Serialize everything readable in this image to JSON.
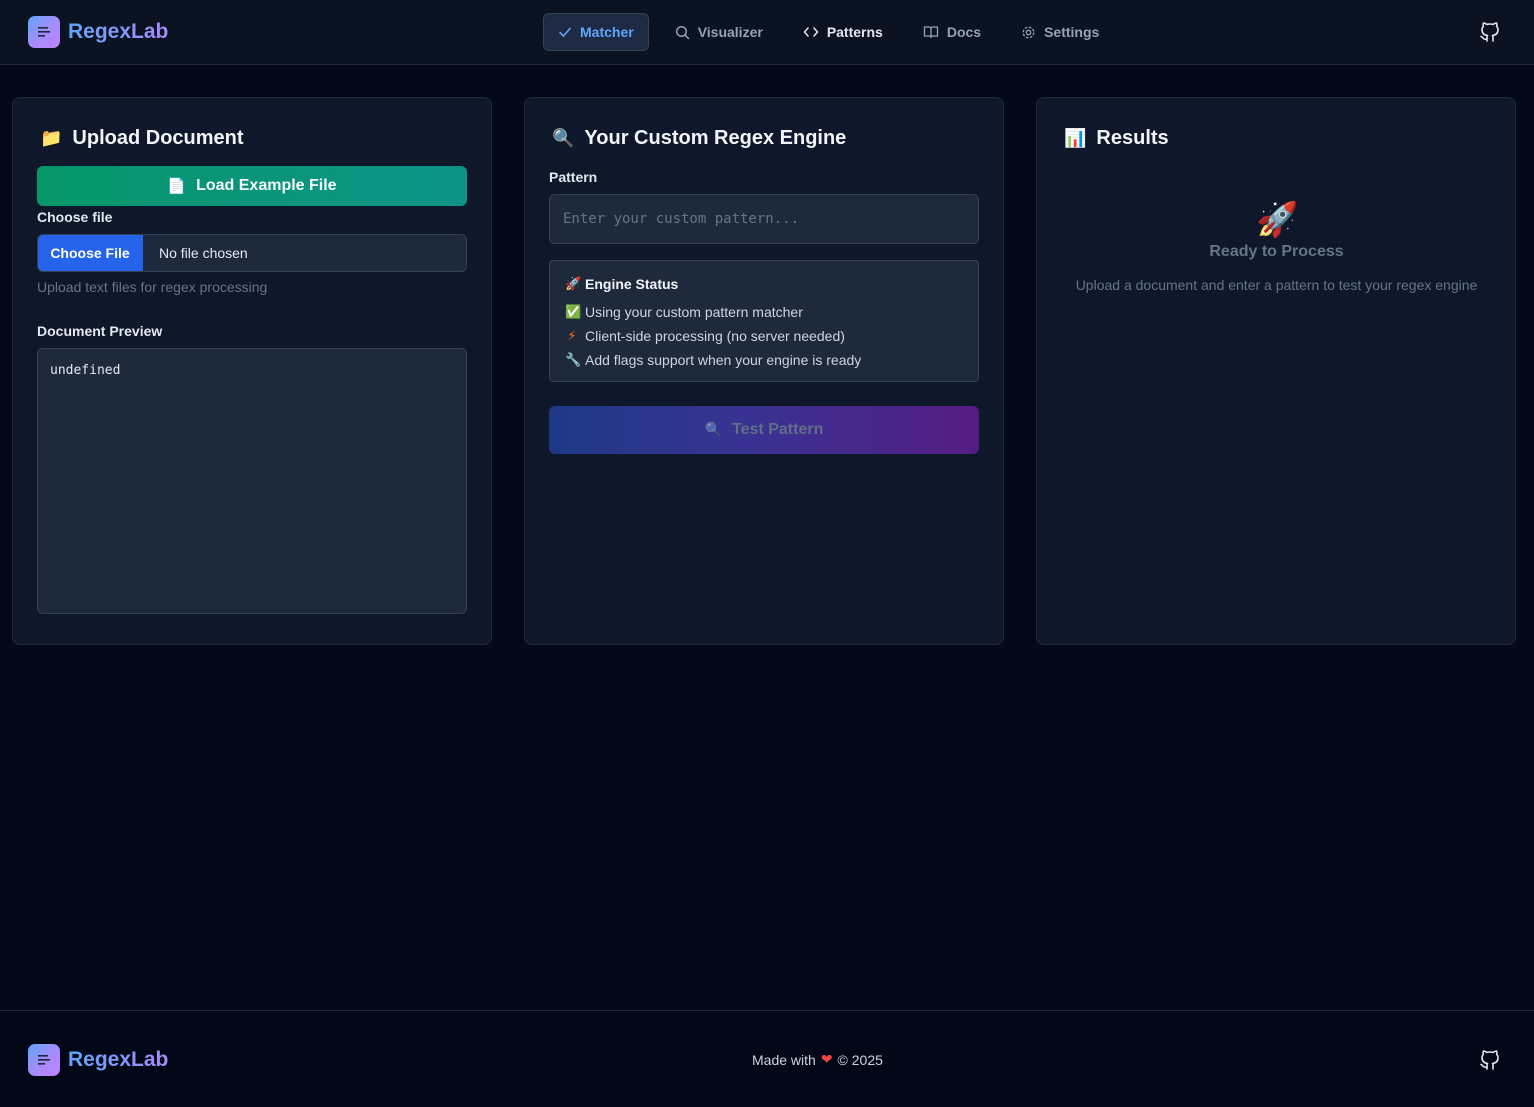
{
  "header": {
    "brand": "RegexLab",
    "nav": [
      {
        "label": "Matcher",
        "icon": "check-icon",
        "active": true
      },
      {
        "label": "Visualizer",
        "icon": "search-icon"
      },
      {
        "label": "Patterns",
        "icon": "code-icon"
      },
      {
        "label": "Docs",
        "icon": "book-icon"
      },
      {
        "label": "Settings",
        "icon": "gear-icon"
      }
    ],
    "github_icon": "github-icon"
  },
  "upload": {
    "emoji": "📁",
    "title": "Upload Document",
    "load_button": "Load Example File",
    "load_button_emoji": "📄",
    "choose_label": "Choose file",
    "choose_button": "Choose File",
    "file_status": "No file chosen",
    "hint": "Upload text files for regex processing",
    "preview_label": "Document Preview",
    "preview_text": "undefined"
  },
  "engine": {
    "emoji": "🔍",
    "title": "Your Custom Regex Engine",
    "pattern_label": "Pattern",
    "pattern_placeholder": "Enter your custom pattern...",
    "status_emoji": "🚀",
    "status_title": "Engine Status",
    "status_lines": [
      {
        "emoji": "✅",
        "text": "Using your custom pattern matcher"
      },
      {
        "emoji": "⚡",
        "text": "Client-side processing (no server needed)"
      },
      {
        "emoji": "🔧",
        "text": "Add flags support when your engine is ready"
      }
    ],
    "test_button": "Test Pattern",
    "test_button_emoji": "🔍"
  },
  "results": {
    "emoji": "📊",
    "title": "Results",
    "ready_emoji": "🚀",
    "ready_title": "Ready to Process",
    "ready_sub": "Upload a document and enter a pattern to test your regex engine"
  },
  "footer": {
    "brand": "RegexLab",
    "made_with": "Made with",
    "heart": "❤",
    "year": "© 2025"
  },
  "colors": {
    "background": "#020817",
    "card": "#0f172a",
    "accent_blue": "#60a5fa",
    "green_button": "#059669",
    "choose_button": "#2563eb"
  }
}
